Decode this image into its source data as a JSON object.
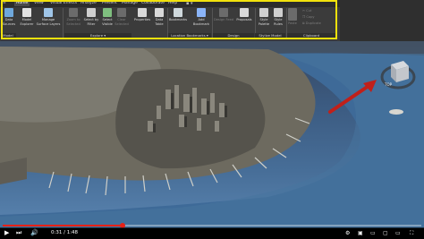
{
  "ribbon": {
    "tabs": [
      "Home",
      "View",
      "Visual Effects",
      "Analyze",
      "Present",
      "Manage",
      "Collaborate",
      "Help"
    ],
    "active_tab": "Home",
    "tools": [
      {
        "label1": "Data",
        "label2": "Sources",
        "color": "#6fa8dc",
        "enabled": true
      },
      {
        "label1": "Model",
        "label2": "Explorer",
        "color": "#e2e2e2",
        "enabled": true
      },
      {
        "label1": "Manage",
        "label2": "Surface Layers",
        "color": "#9fc5e8",
        "enabled": true
      },
      {
        "label1": "Zoom to",
        "label2": "Selected",
        "color": "#6b6b6b",
        "enabled": false
      },
      {
        "label1": "Select by",
        "label2": "Filter",
        "color": "#cfcfcf",
        "enabled": true
      },
      {
        "label1": "Select",
        "label2": "Visible",
        "color": "#7fbf7f",
        "enabled": true
      },
      {
        "label1": "Clear",
        "label2": "Selected",
        "color": "#6b6b6b",
        "enabled": false
      },
      {
        "label1": "Properties",
        "label2": "",
        "color": "#d9d9d9",
        "enabled": true
      },
      {
        "label1": "Data",
        "label2": "Table",
        "color": "#d9d9d9",
        "enabled": true
      },
      {
        "label1": "Bookmarks",
        "label2": "",
        "color": "#cfd8dc",
        "enabled": true
      },
      {
        "label1": "Add",
        "label2": "Bookmark",
        "color": "#8ab4f8",
        "enabled": true
      },
      {
        "label1": "Design Feed",
        "label2": "",
        "color": "#6b6b6b",
        "enabled": false
      },
      {
        "label1": "Proposals",
        "label2": "",
        "color": "#d9d9d9",
        "enabled": true
      },
      {
        "label1": "Style",
        "label2": "Palette",
        "color": "#cfcfcf",
        "enabled": true
      },
      {
        "label1": "Style",
        "label2": "Rules",
        "color": "#cfcfcf",
        "enabled": true
      }
    ],
    "groups": [
      "Model",
      "Explore",
      "Location Bookmarks",
      "Design",
      "Stylize Model",
      "Clipboard"
    ],
    "clipboard": {
      "cut": "Cut",
      "copy": "Copy",
      "duplicate": "Duplicate",
      "paste": "Paste"
    }
  },
  "viewcube": {
    "label": "TOP"
  },
  "video": {
    "current_time": "0:31",
    "total_time": "1:48",
    "time_text": "0:31 / 1:48",
    "progress": 0.287
  },
  "colors": {
    "highlight": "#f2e20c",
    "arrow": "#c0201a",
    "progress": "#e62117"
  }
}
